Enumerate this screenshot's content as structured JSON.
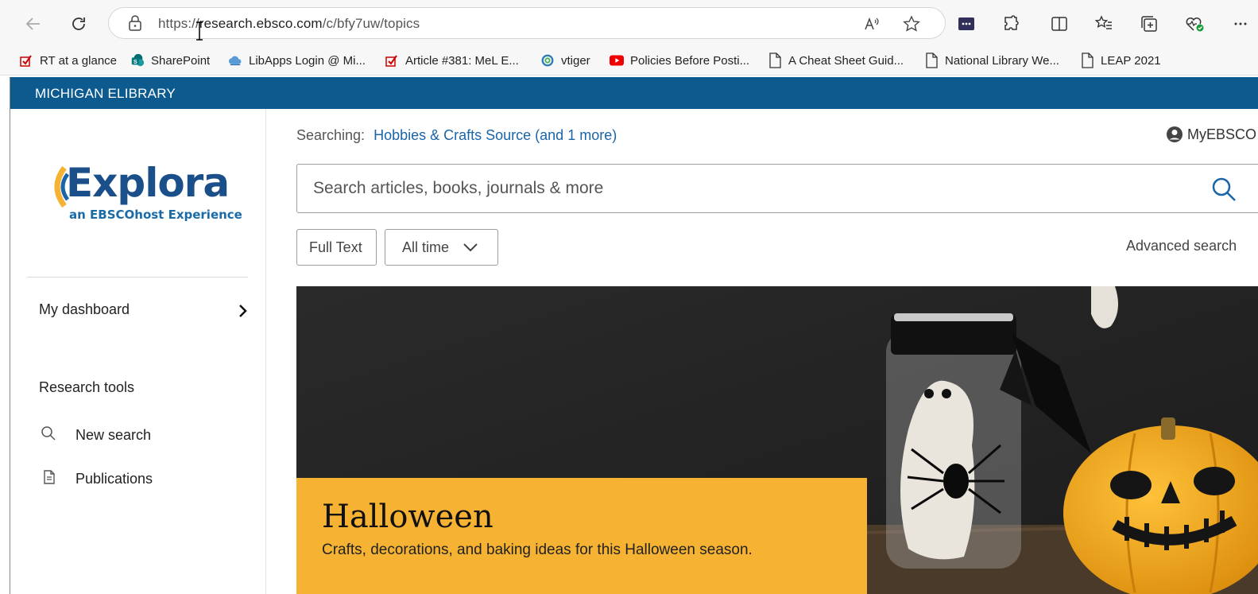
{
  "browser": {
    "url_scheme": "https://",
    "url_host": "research.ebsco.com",
    "url_path": "/c/bfy7uw/topics"
  },
  "bookmarks": [
    {
      "label": "RT at a glance",
      "icon": "checkmark-icon"
    },
    {
      "label": "SharePoint",
      "icon": "sharepoint-icon"
    },
    {
      "label": "LibApps Login @ Mi...",
      "icon": "cloud-icon"
    },
    {
      "label": "Article #381: MeL E...",
      "icon": "checkmark-icon"
    },
    {
      "label": "vtiger",
      "icon": "vtiger-icon"
    },
    {
      "label": "Policies Before Posti...",
      "icon": "youtube-icon"
    },
    {
      "label": "A Cheat Sheet Guid...",
      "icon": "page-icon"
    },
    {
      "label": "National Library We...",
      "icon": "page-icon"
    },
    {
      "label": "LEAP 2021",
      "icon": "page-icon"
    }
  ],
  "site": {
    "banner": "MICHIGAN ELIBRARY",
    "logo_main": "Explora",
    "logo_sub": "an EBSCOhost Experience",
    "nav": {
      "dashboard": "My dashboard",
      "research_tools": "Research tools",
      "new_search": "New search",
      "publications": "Publications"
    },
    "searching_label": "Searching:",
    "searching_db": "Hobbies & Crafts Source (and 1 more)",
    "account": "MyEBSCO",
    "search_placeholder": "Search articles, books, journals & more",
    "filter_fulltext": "Full Text",
    "filter_time": "All time",
    "advanced_search": "Advanced search",
    "hero": {
      "title": "Halloween",
      "subtitle": "Crafts, decorations, and baking ideas for this Halloween season."
    }
  },
  "colors": {
    "banner": "#0d5a8f",
    "link": "#1a64a8",
    "hero_caption": "#f6b233"
  }
}
